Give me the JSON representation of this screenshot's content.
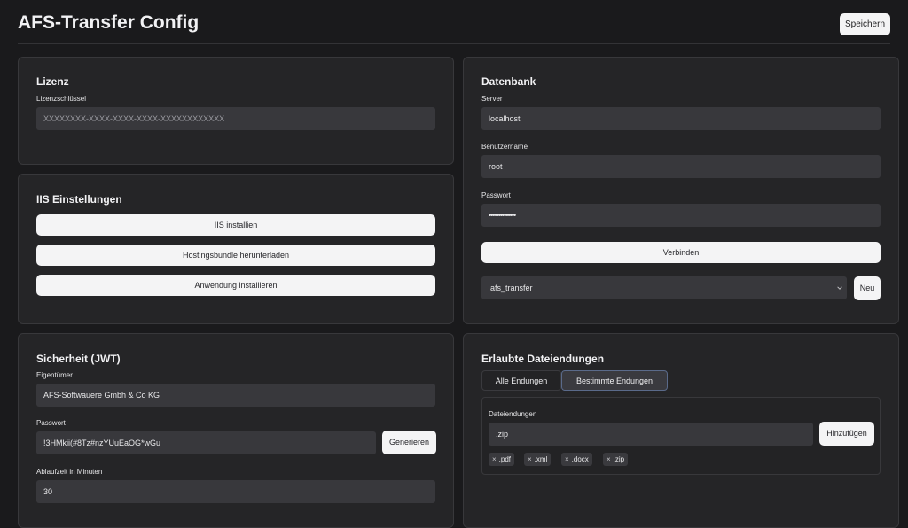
{
  "header": {
    "title": "AFS-Transfer Config",
    "save_label": "Speichern"
  },
  "lizenz": {
    "title": "Lizenz",
    "key_label": "Lizenzschlüssel",
    "key_placeholder": "XXXXXXXX-XXXX-XXXX-XXXX-XXXXXXXXXXXX"
  },
  "iis": {
    "title": "IIS Einstellungen",
    "buttons": [
      "IIS installien",
      "Hostingsbundle herunterladen",
      "Anwendung installieren"
    ]
  },
  "jwt": {
    "title": "Sicherheit (JWT)",
    "owner_label": "Eigentümer",
    "owner_value": "AFS-Softwauere Gmbh & Co KG",
    "password_label": "Passwort",
    "password_value": "!3HMkii(#8Tz#nzYUuEaOG*wGu",
    "generate_label": "Generieren",
    "expiry_label": "Ablaufzeit in Minuten",
    "expiry_value": "30"
  },
  "database": {
    "title": "Datenbank",
    "server_label": "Server",
    "server_value": "localhost",
    "user_label": "Benutzername",
    "user_value": "root",
    "password_label": "Passwort",
    "password_value": "••••••••••••••",
    "connect_label": "Verbinden",
    "selected_db": "afs_transfer",
    "new_label": "Neu"
  },
  "extensions": {
    "title": "Erlaubte Dateiendungen",
    "tabs": [
      {
        "label": "Alle Endungen",
        "active": false
      },
      {
        "label": "Bestimmte Endungen",
        "active": true
      }
    ],
    "field_label": "Dateiendungen",
    "input_value": ".zip",
    "add_label": "Hinzufügen",
    "tags": [
      ".pdf",
      ".xml",
      ".docx",
      ".zip"
    ],
    "tag_remove_glyph": "×"
  }
}
